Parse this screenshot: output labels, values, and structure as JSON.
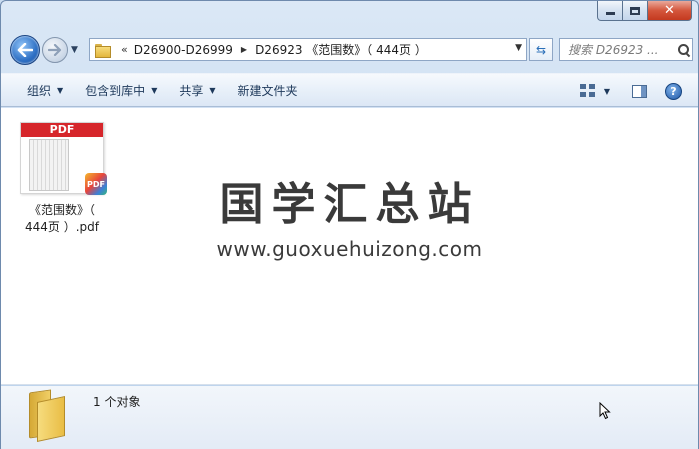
{
  "address": {
    "overflow": "«",
    "crumbs": [
      "D26900-D26999",
      "D26923 《范围数》（ 444页 ）"
    ]
  },
  "search": {
    "placeholder": "搜索 D26923 ..."
  },
  "toolbar": {
    "organize": "组织",
    "include_in_library": "包含到库中",
    "share": "共享",
    "new_folder": "新建文件夹"
  },
  "file": {
    "thumb_label": "PDF",
    "badge_label": "PDF",
    "name_line1": "《范围数》（",
    "name_line2": "444页 ）.pdf"
  },
  "watermark": {
    "title": "国学汇总站",
    "url": "www.guoxuehuizong.com"
  },
  "status": {
    "count": "1 个对象"
  },
  "icons": {
    "back": "back-arrow-icon",
    "forward": "forward-arrow-icon",
    "refresh": "refresh-icon",
    "search": "search-icon",
    "help": "help-icon"
  },
  "colors": {
    "pdf_red": "#d6262b",
    "accent_blue": "#2d6fc4"
  }
}
